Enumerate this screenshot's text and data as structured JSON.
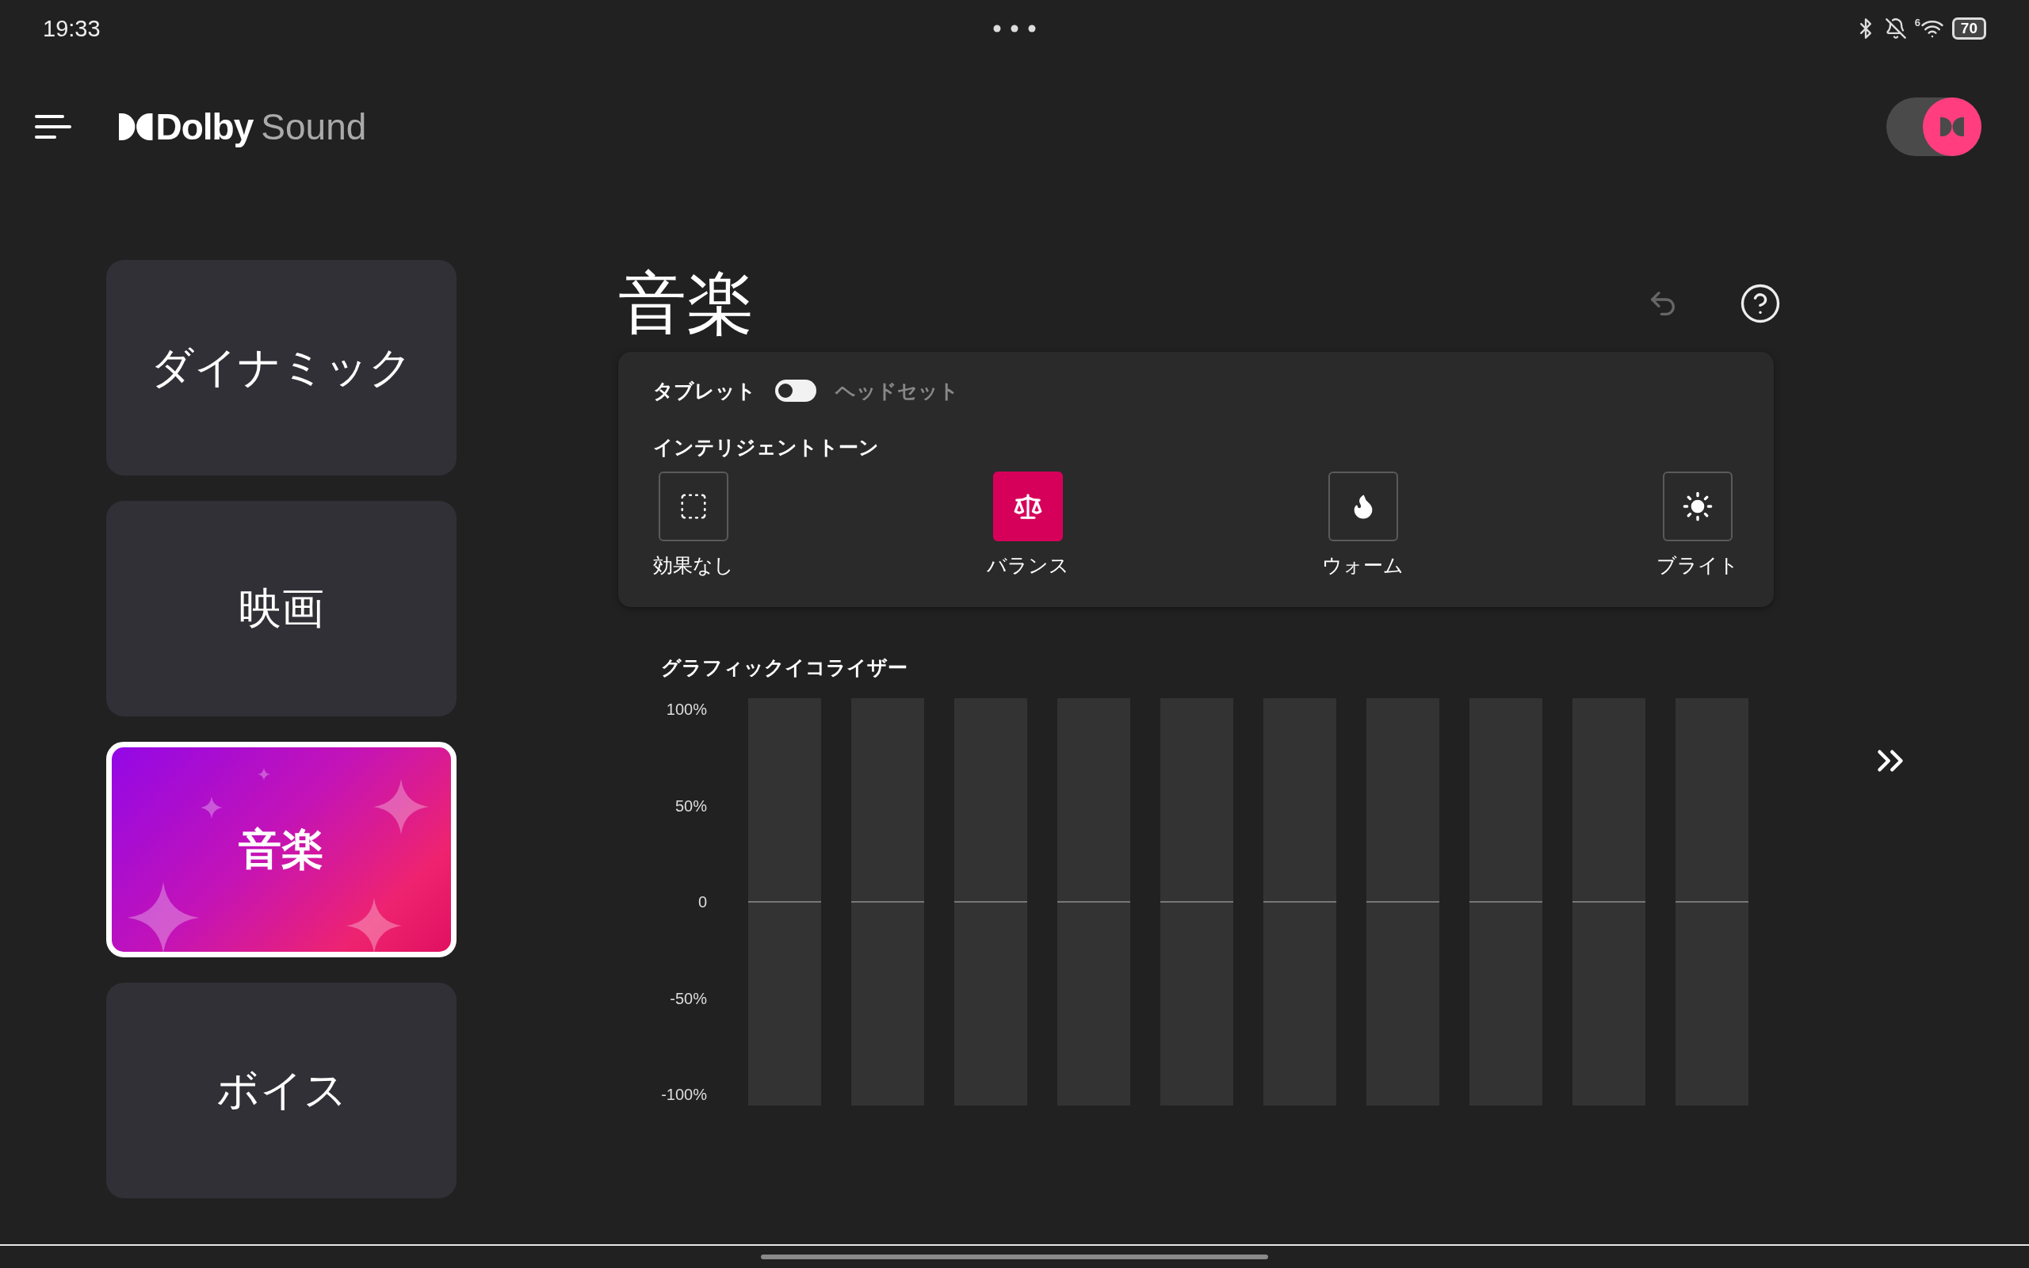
{
  "status_bar": {
    "time": "19:33",
    "wifi_badge": "6",
    "battery": "70"
  },
  "header": {
    "brand": "Dolby",
    "product": "Sound",
    "dolby_switch": {
      "on": true
    }
  },
  "profiles": [
    {
      "label": "ダイナミック",
      "selected": false
    },
    {
      "label": "映画",
      "selected": false
    },
    {
      "label": "音楽",
      "selected": true
    },
    {
      "label": "ボイス",
      "selected": false
    }
  ],
  "page": {
    "title": "音楽"
  },
  "output": {
    "left_label": "タブレット",
    "right_label": "ヘッドセット",
    "on": false
  },
  "intelligent_tone": {
    "title": "インテリジェントトーン",
    "options": [
      {
        "label": "効果なし",
        "kind": "none",
        "selected": false
      },
      {
        "label": "バランス",
        "kind": "balance",
        "selected": true
      },
      {
        "label": "ウォーム",
        "kind": "warm",
        "selected": false
      },
      {
        "label": "ブライト",
        "kind": "bright",
        "selected": false
      }
    ]
  },
  "equalizer": {
    "title": "グラフィックイコライザー",
    "ticks": [
      "100%",
      "50%",
      "0",
      "-50%",
      "-100%"
    ],
    "bands": [
      {
        "level": 0.5
      },
      {
        "level": 0.5
      },
      {
        "level": 0.5
      },
      {
        "level": 0.5
      },
      {
        "level": 0.5
      },
      {
        "level": 0.5
      },
      {
        "level": 0.5
      },
      {
        "level": 0.5
      },
      {
        "level": 0.5
      },
      {
        "level": 0.5
      }
    ]
  }
}
